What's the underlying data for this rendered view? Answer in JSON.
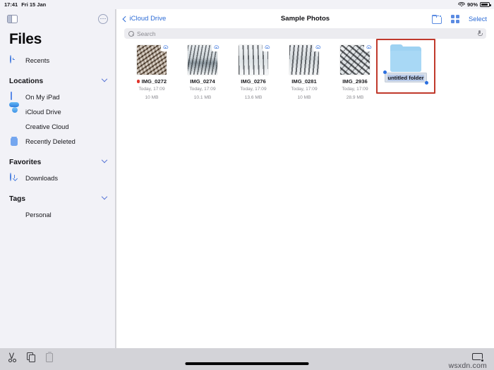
{
  "status_bar": {
    "time": "17:41",
    "date": "Fri 15 Jan",
    "battery_percent": "90%",
    "wifi_icon": "wifi-icon",
    "battery_icon": "battery-icon"
  },
  "sidebar": {
    "toggle_icon": "sidebar-toggle-icon",
    "more_icon": "more-options-icon",
    "app_title": "Files",
    "recents": {
      "label": "Recents",
      "icon": "clock-icon"
    },
    "sections": [
      {
        "title": "Locations",
        "items": [
          {
            "label": "On My iPad",
            "icon": "ipad-icon"
          },
          {
            "label": "iCloud Drive",
            "icon": "icloud-icon"
          },
          {
            "label": "Creative Cloud",
            "icon": "creative-cloud-icon"
          },
          {
            "label": "Recently Deleted",
            "icon": "trash-icon"
          }
        ]
      },
      {
        "title": "Favorites",
        "items": [
          {
            "label": "Downloads",
            "icon": "download-circle-icon"
          }
        ]
      },
      {
        "title": "Tags",
        "items": [
          {
            "label": "Personal",
            "icon": "tag-dot-icon",
            "color": "#e0342b"
          }
        ]
      }
    ]
  },
  "navbar": {
    "back_label": "iCloud Drive",
    "back_icon": "chevron-left-icon",
    "title": "Sample Photos",
    "new_folder_icon": "new-folder-icon",
    "grid_view_icon": "grid-view-icon",
    "select_label": "Select"
  },
  "search": {
    "placeholder": "Search",
    "value": "",
    "search_icon": "search-icon",
    "mic_icon": "microphone-icon"
  },
  "files": [
    {
      "name": "IMG_0272",
      "date": "Today, 17:09",
      "size": "10 MB",
      "tag_color": "#e0342b",
      "badge": "icloud-download-icon"
    },
    {
      "name": "IMG_0274",
      "date": "Today, 17:09",
      "size": "10.1 MB",
      "tag_color": "",
      "badge": "icloud-download-icon"
    },
    {
      "name": "IMG_0276",
      "date": "Today, 17:09",
      "size": "13.6 MB",
      "tag_color": "",
      "badge": "icloud-download-icon"
    },
    {
      "name": "IMG_0281",
      "date": "Today, 17:09",
      "size": "10 MB",
      "tag_color": "",
      "badge": "icloud-download-icon"
    },
    {
      "name": "IMG_2936",
      "date": "Today, 17:09",
      "size": "28.9 MB",
      "tag_color": "",
      "badge": "icloud-download-icon"
    }
  ],
  "new_folder": {
    "name_value": "untitled folder",
    "folder_icon": "folder-icon",
    "state": "renaming-text-selected",
    "highlight_color": "#c0392b"
  },
  "bottom_toolbar": {
    "cut_icon": "cut-icon",
    "copy_icon": "copy-icon",
    "paste_icon": "paste-icon",
    "keyboard_dismiss_icon": "keyboard-dismiss-icon"
  },
  "watermark": "wsxdn.com"
}
